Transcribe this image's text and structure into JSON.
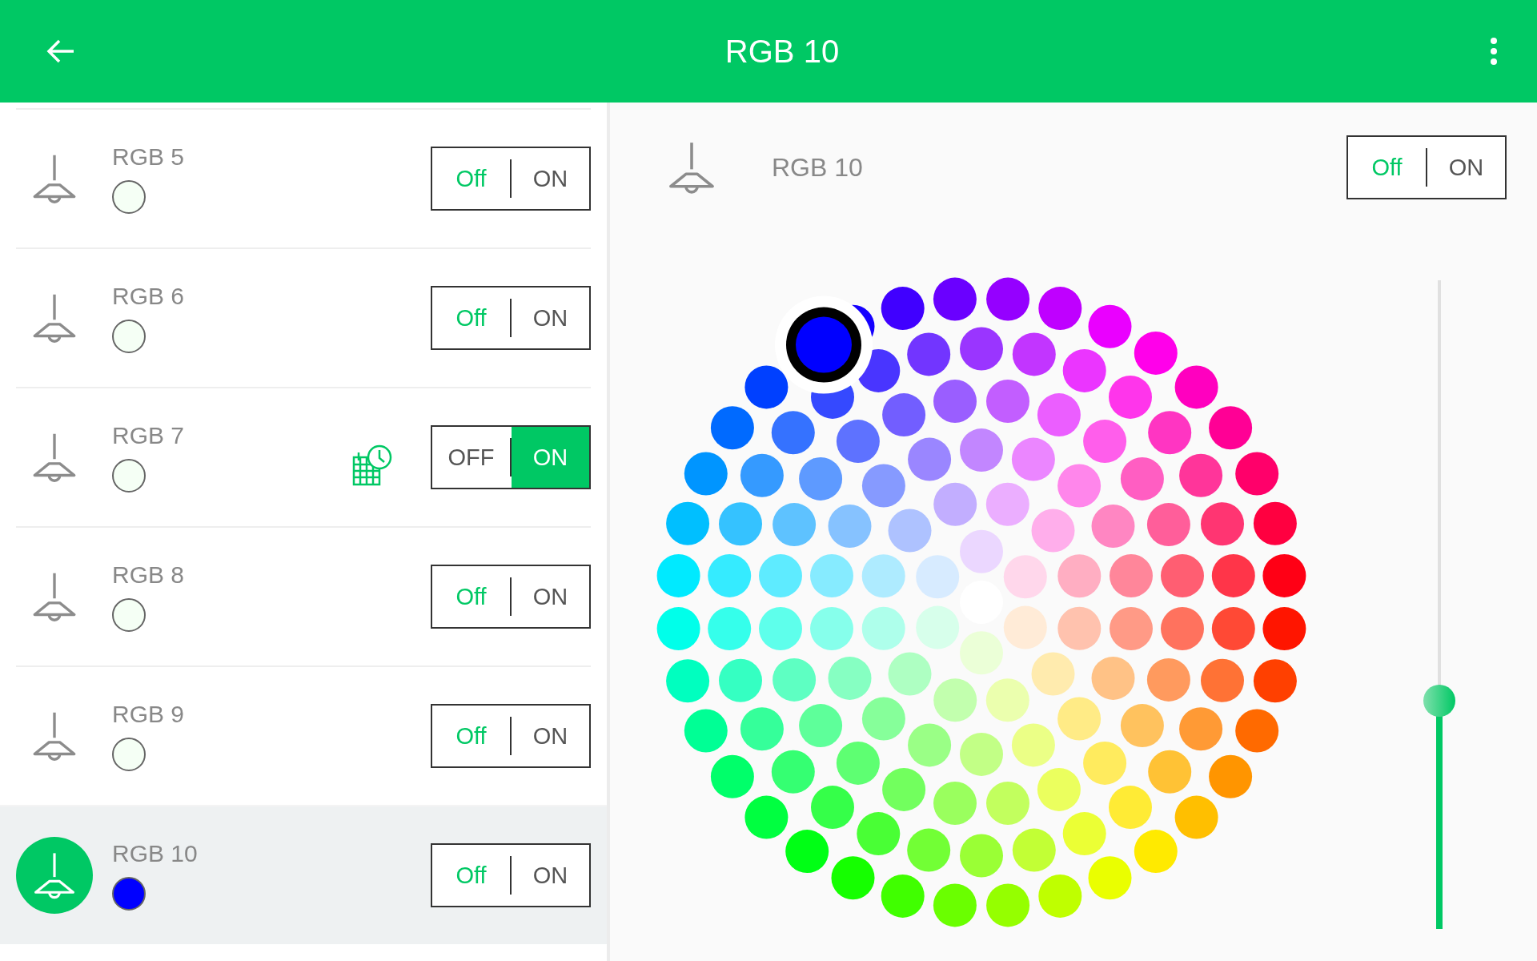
{
  "app_bar": {
    "title": "RGB 10"
  },
  "devices": [
    {
      "name": "RGB 5",
      "color": "#f5fff5",
      "selected": false,
      "scheduled": false,
      "switch": {
        "off_label": "Off",
        "on_label": "ON",
        "on": false
      }
    },
    {
      "name": "RGB 6",
      "color": "#f5fff5",
      "selected": false,
      "scheduled": false,
      "switch": {
        "off_label": "Off",
        "on_label": "ON",
        "on": false
      }
    },
    {
      "name": "RGB 7",
      "color": "#f5fff5",
      "selected": false,
      "scheduled": true,
      "switch": {
        "off_label": "OFF",
        "on_label": "ON",
        "on": true
      }
    },
    {
      "name": "RGB 8",
      "color": "#f5fff5",
      "selected": false,
      "scheduled": false,
      "switch": {
        "off_label": "Off",
        "on_label": "ON",
        "on": false
      }
    },
    {
      "name": "RGB 9",
      "color": "#f5fff5",
      "selected": false,
      "scheduled": false,
      "switch": {
        "off_label": "Off",
        "on_label": "ON",
        "on": false
      }
    },
    {
      "name": "RGB 10",
      "color": "#0000ff",
      "selected": true,
      "scheduled": false,
      "switch": {
        "off_label": "Off",
        "on_label": "ON",
        "on": false
      }
    }
  ],
  "detail": {
    "name": "RGB 10",
    "switch": {
      "off_label": "Off",
      "on_label": "ON",
      "on": false
    },
    "brightness": {
      "level": 0.35
    }
  }
}
